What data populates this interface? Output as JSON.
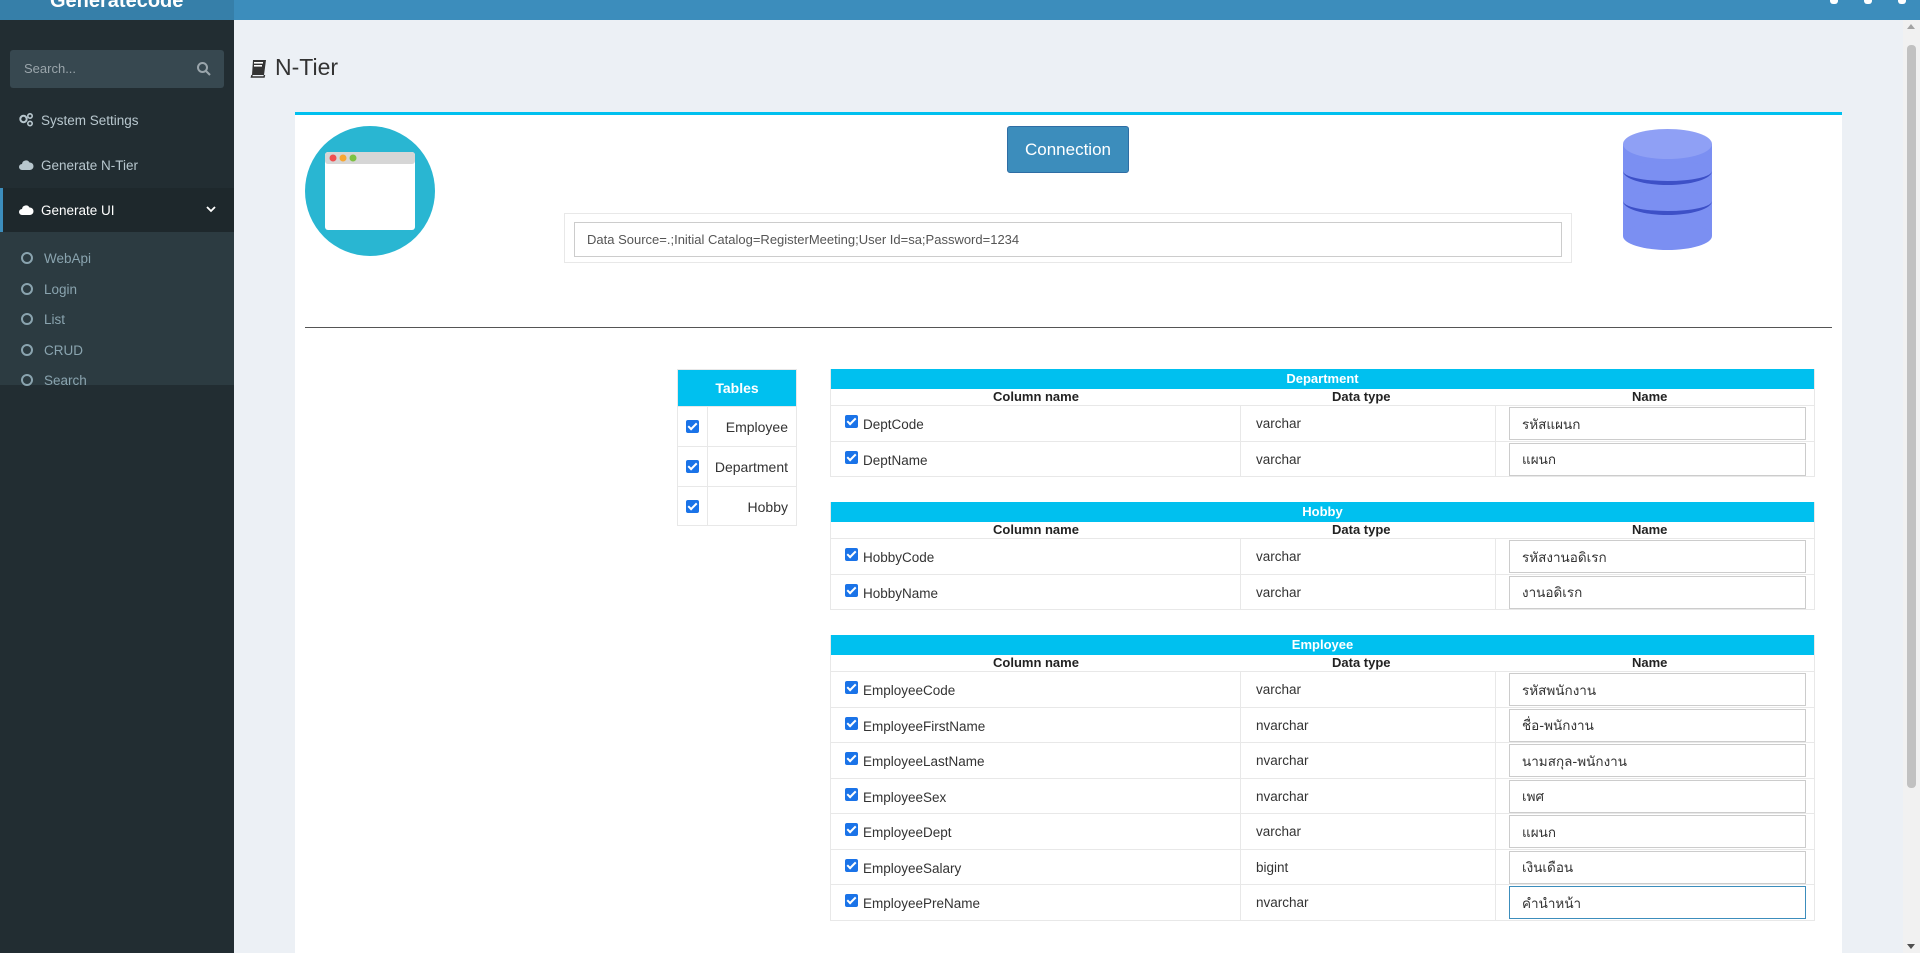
{
  "app": {
    "logo_text": "Generatecode"
  },
  "sidebar": {
    "search_placeholder": "Search...",
    "items": [
      {
        "label": "System Settings",
        "icon": "gears-icon"
      },
      {
        "label": "Generate N-Tier",
        "icon": "cloud-icon"
      },
      {
        "label": "Generate UI",
        "icon": "cloud-icon",
        "expanded": true
      }
    ],
    "subitems": [
      "WebApi",
      "Login",
      "List",
      "CRUD",
      "Search"
    ]
  },
  "page": {
    "title": "N-Tier",
    "title_icon": "book-icon"
  },
  "connection": {
    "button_label": "Connection",
    "value": "Data Source=.;Initial Catalog=RegisterMeeting;User Id=sa;Password=1234"
  },
  "tables_panel": {
    "header": "Tables",
    "items": [
      {
        "label": "Employee",
        "checked": true
      },
      {
        "label": "Department",
        "checked": true
      },
      {
        "label": "Hobby",
        "checked": true
      }
    ]
  },
  "column_headers": {
    "column_name": "Column name",
    "data_type": "Data type",
    "name": "Name"
  },
  "tables": [
    {
      "name": "Department",
      "rows": [
        {
          "column": "DeptCode",
          "type": "varchar",
          "name": "รหัสแผนก",
          "checked": true
        },
        {
          "column": "DeptName",
          "type": "varchar",
          "name": "แผนก",
          "checked": true
        }
      ]
    },
    {
      "name": "Hobby",
      "rows": [
        {
          "column": "HobbyCode",
          "type": "varchar",
          "name": "รหัสงานอดิเรก",
          "checked": true
        },
        {
          "column": "HobbyName",
          "type": "varchar",
          "name": "งานอดิเรก",
          "checked": true
        }
      ]
    },
    {
      "name": "Employee",
      "rows": [
        {
          "column": "EmployeeCode",
          "type": "varchar",
          "name": "รหัสพนักงาน",
          "checked": true
        },
        {
          "column": "EmployeeFirstName",
          "type": "nvarchar",
          "name": "ชื่อ-พนักงาน",
          "checked": true
        },
        {
          "column": "EmployeeLastName",
          "type": "nvarchar",
          "name": "นามสกุล-พนักงาน",
          "checked": true
        },
        {
          "column": "EmployeeSex",
          "type": "nvarchar",
          "name": "เพศ",
          "checked": true
        },
        {
          "column": "EmployeeDept",
          "type": "varchar",
          "name": "แผนก",
          "checked": true
        },
        {
          "column": "EmployeeSalary",
          "type": "bigint",
          "name": "เงินเดือน",
          "checked": true
        },
        {
          "column": "EmployeePreName",
          "type": "nvarchar",
          "name": "คำนำหน้า",
          "checked": true
        }
      ]
    }
  ],
  "colors": {
    "header_blue": "#3c8dbc",
    "accent_cyan": "#00c0ef",
    "sidebar_dark": "#222d32"
  }
}
